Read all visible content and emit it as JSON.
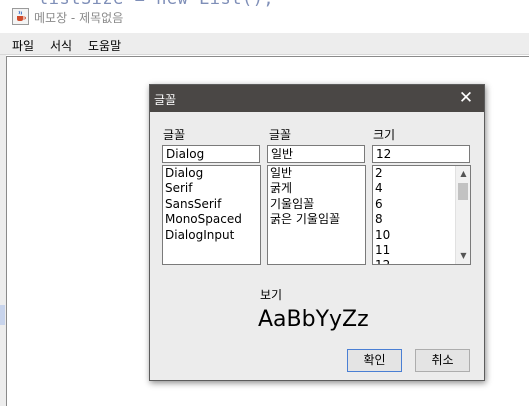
{
  "app": {
    "title": "메모장 - 제목없음",
    "background_code": "listSize = new List();",
    "icon": "java-cup-icon"
  },
  "menubar": {
    "items": [
      "파일",
      "서식",
      "도움말"
    ]
  },
  "font_dialog": {
    "title": "글꼴",
    "close_icon": "close-icon",
    "font": {
      "label": "글꼴",
      "value": "Dialog",
      "options": [
        "Dialog",
        "Serif",
        "SansSerif",
        "MonoSpaced",
        "DialogInput"
      ]
    },
    "style": {
      "label": "글꼴",
      "value": "일반",
      "options": [
        "일반",
        "굵게",
        "기울임꼴",
        "굵은 기울임꼴"
      ]
    },
    "size": {
      "label": "크기",
      "value": "12",
      "options": [
        "2",
        "4",
        "6",
        "8",
        "10",
        "11",
        "12"
      ]
    },
    "preview": {
      "label": "보기",
      "sample": "AaBbYyZz"
    },
    "ok_label": "확인",
    "cancel_label": "취소"
  },
  "colors": {
    "dialog_title_bg": "#4a4745",
    "dialog_bg": "#ececec",
    "menubar_bg": "#ededed",
    "ok_border": "#4a7fd4"
  }
}
